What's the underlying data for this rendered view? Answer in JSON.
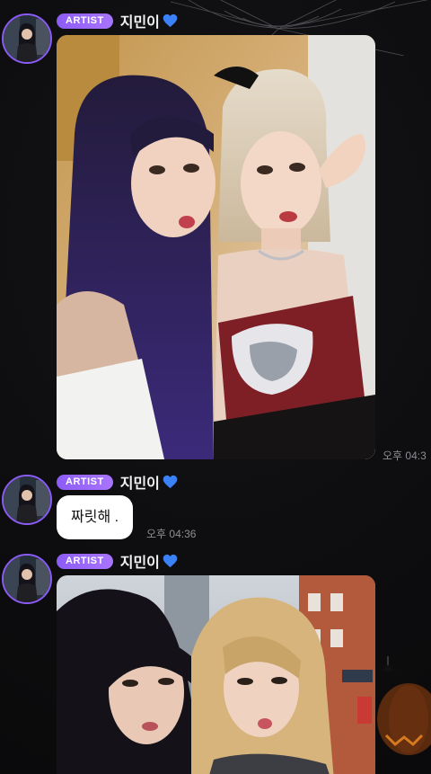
{
  "messages": [
    {
      "badge": "ARTIST",
      "sender": "지민이",
      "type": "photo",
      "timestamp": "오후 04:3"
    },
    {
      "badge": "ARTIST",
      "sender": "지민이",
      "type": "text",
      "text": "짜릿해 .",
      "timestamp": "오후 04:36"
    },
    {
      "badge": "ARTIST",
      "sender": "지민이",
      "type": "photo"
    }
  ],
  "colors": {
    "badge": "#8d5cf6",
    "avatar_ring": "#8b5cf6",
    "heart": "#3b82f6",
    "background": "#0b0b0c",
    "bubble": "#ffffff"
  },
  "icons": {
    "heart": "blue-heart-icon",
    "decoration_top": "spider-web-icon",
    "decoration_bottom": "pumpkin-spider-icon"
  }
}
